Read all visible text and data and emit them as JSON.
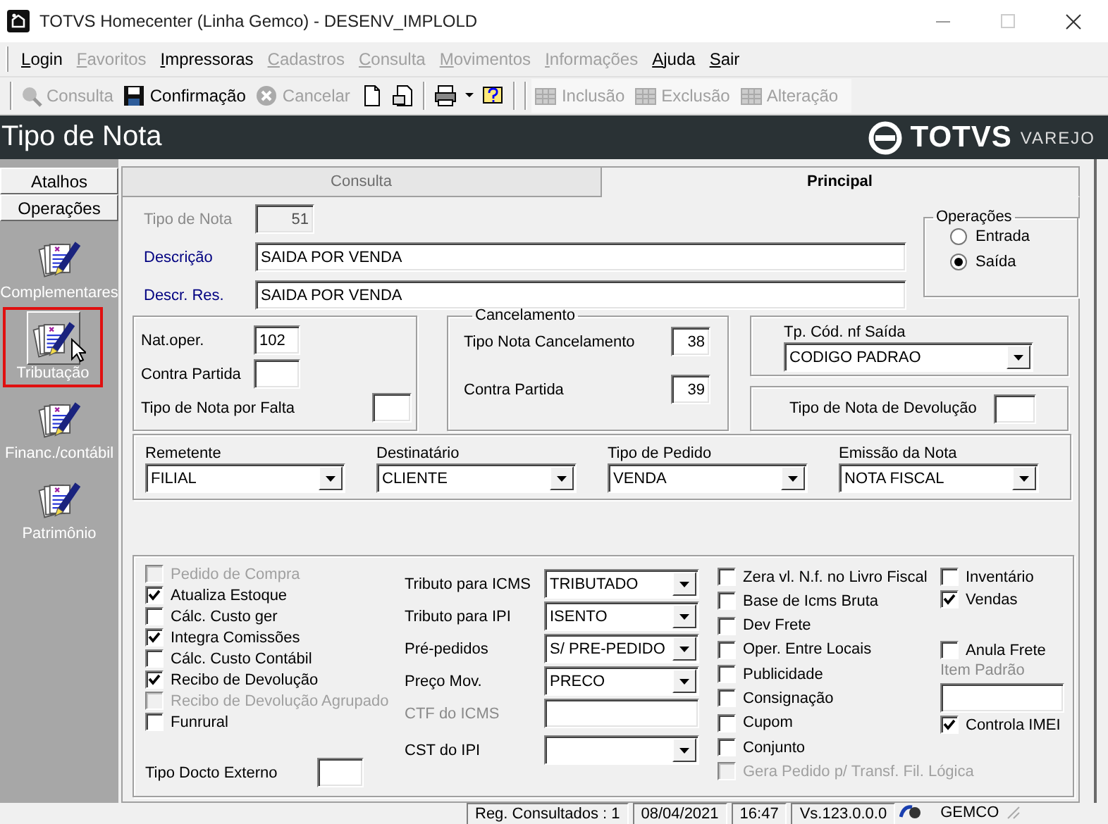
{
  "window": {
    "title": "TOTVS Homecenter (Linha Gemco) - DESENV_IMPLOLD"
  },
  "menu": [
    {
      "label": "Login",
      "disabled": false
    },
    {
      "label": "Favoritos",
      "disabled": true
    },
    {
      "label": "Impressoras",
      "disabled": false
    },
    {
      "label": "Cadastros",
      "disabled": true
    },
    {
      "label": "Consulta",
      "disabled": true
    },
    {
      "label": "Movimentos",
      "disabled": true
    },
    {
      "label": "Informações",
      "disabled": true
    },
    {
      "label": "Ajuda",
      "disabled": false
    },
    {
      "label": "Sair",
      "disabled": false
    }
  ],
  "toolbar": {
    "left": [
      {
        "label": "Consulta",
        "disabled": true
      },
      {
        "label": "Confirmação",
        "disabled": false
      },
      {
        "label": "Cancelar",
        "disabled": true
      }
    ],
    "right": [
      {
        "label": "Inclusão",
        "disabled": true
      },
      {
        "label": "Exclusão",
        "disabled": true
      },
      {
        "label": "Alteração",
        "disabled": true
      }
    ]
  },
  "header": {
    "title": "Tipo de Nota",
    "logo": "TOTVS",
    "logo_sub": "VAREJO"
  },
  "sidebar": {
    "sections": [
      "Atalhos",
      "Operações"
    ],
    "items": [
      {
        "label": "Complementares",
        "selected": false
      },
      {
        "label": "Tributação",
        "selected": true
      },
      {
        "label": "Financ./contábil",
        "selected": false
      },
      {
        "label": "Patrimônio",
        "selected": false
      }
    ]
  },
  "tabs": [
    {
      "label": "Consulta",
      "selected": false
    },
    {
      "label": "Principal",
      "selected": true
    }
  ],
  "form": {
    "tipo_de_nota": {
      "label": "Tipo de Nota",
      "value": "51",
      "disabled": true
    },
    "descricao": {
      "label": "Descrição",
      "value": "SAIDA POR VENDA",
      "required": true
    },
    "descr_res": {
      "label": "Descr. Res.",
      "value": "SAIDA POR VENDA",
      "required": true
    },
    "operacoes": {
      "title": "Operações",
      "options": [
        {
          "label": "Entrada",
          "selected": false
        },
        {
          "label": "Saída",
          "selected": true
        }
      ]
    },
    "natureza": [
      {
        "label": "Nat.oper.",
        "value": "102"
      },
      {
        "label": "Contra Partida"
      },
      {
        "label": "Tipo de Nota por Falta"
      }
    ],
    "cancelamento": {
      "title": "Cancelamento",
      "fields": [
        {
          "label": "Tipo Nota Cancelamento",
          "value": "38"
        },
        {
          "label": "Contra Partida",
          "value": "39"
        }
      ]
    },
    "tp_cod_nf_saida": {
      "label": "Tp. Cód. nf Saída",
      "value": "CODIGO PADRAO"
    },
    "tipo_nota_devolucao": {
      "label": "Tipo de Nota de Devolução"
    },
    "selects": [
      {
        "label": "Remetente",
        "value": "FILIAL"
      },
      {
        "label": "Destinatário",
        "value": "CLIENTE"
      },
      {
        "label": "Tipo de Pedido",
        "value": "VENDA"
      },
      {
        "label": "Emissão da Nota",
        "value": "NOTA FISCAL"
      }
    ],
    "checks_left": [
      {
        "label": "Pedido de Compra",
        "checked": false,
        "disabled": true
      },
      {
        "label": "Atualiza Estoque",
        "checked": true,
        "disabled": false
      },
      {
        "label": "Cálc. Custo ger",
        "checked": false,
        "disabled": false
      },
      {
        "label": "Integra Comissões",
        "checked": true,
        "disabled": false
      },
      {
        "label": "Cálc. Custo Contábil",
        "checked": false,
        "disabled": false
      },
      {
        "label": "Recibo de Devolução",
        "checked": true,
        "disabled": false
      },
      {
        "label": "Recibo de Devolução Agrupado",
        "checked": false,
        "disabled": true
      },
      {
        "label": "Funrural",
        "checked": false,
        "disabled": false
      }
    ],
    "tipo_docto_externo": {
      "label": "Tipo Docto Externo"
    },
    "tributos": [
      {
        "kind": "select",
        "label": "Tributo para ICMS",
        "value": "TRIBUTADO",
        "disabled": false
      },
      {
        "kind": "select",
        "label": "Tributo para IPI",
        "value": "ISENTO",
        "disabled": false
      },
      {
        "kind": "select",
        "label": "Pré-pedidos",
        "value": "S/ PRE-PEDIDO",
        "disabled": false
      },
      {
        "kind": "select",
        "label": "Preço Mov.",
        "value": "PRECO",
        "disabled": false
      },
      {
        "kind": "text",
        "label": "CTF do ICMS",
        "disabled": true
      },
      {
        "kind": "select",
        "label": "CST do IPI",
        "disabled": false
      }
    ],
    "checks_middle": [
      {
        "label": "Zera vl. N.f. no Livro Fiscal",
        "checked": false,
        "disabled": false
      },
      {
        "label": "Base de Icms Bruta",
        "checked": false,
        "disabled": false
      },
      {
        "label": "Dev Frete",
        "checked": false,
        "disabled": false
      },
      {
        "label": "Oper. Entre Locais",
        "checked": false,
        "disabled": false
      },
      {
        "label": "Publicidade",
        "checked": false,
        "disabled": false
      },
      {
        "label": "Consignação",
        "checked": false,
        "disabled": false
      },
      {
        "label": "Cupom",
        "checked": false,
        "disabled": false
      },
      {
        "label": "Conjunto",
        "checked": false,
        "disabled": false
      },
      {
        "label": "Gera Pedido p/ Transf. Fil. Lógica",
        "checked": false,
        "disabled": true
      }
    ],
    "checks_right": [
      {
        "label": "Inventário",
        "checked": false,
        "disabled": false
      },
      {
        "label": "Vendas",
        "checked": true,
        "disabled": false
      },
      {
        "label": "Anula Frete",
        "checked": false,
        "disabled": false
      }
    ],
    "item_padrao": {
      "label": "Item Padrão",
      "disabled": true
    },
    "controla_imei": {
      "label": "Controla IMEI",
      "checked": true,
      "disabled": false
    }
  },
  "status_bar": {
    "panels": [
      "Reg. Consultados : 1",
      "08/04/2021",
      "16:47",
      "Vs.123.0.0.0"
    ],
    "user": "GEMCO"
  }
}
